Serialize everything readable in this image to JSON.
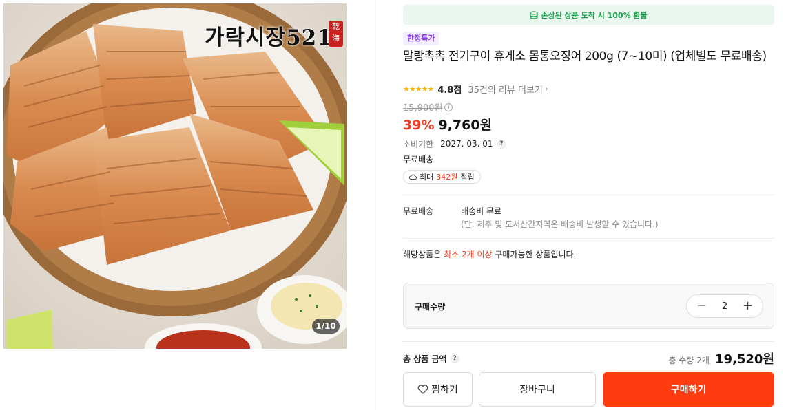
{
  "gallery": {
    "brand_text": "가락시장521",
    "seal_text": "乾海",
    "counter": "1/10"
  },
  "notice": {
    "text": "손상된 상품 도착 시 100% 환불",
    "icon": "coin-stack-icon"
  },
  "product": {
    "tag": "한정특가",
    "title": "말랑촉촉 전기구이 휴게소 몸통오징어 200g (7~10미) (업체별도 무료배송)",
    "stars": "★★★★★",
    "rating": "4.8점",
    "reviews_link": "35건의 리뷰 더보기",
    "original_price": "15,900원",
    "discount": "39%",
    "sale_price": "9,760원",
    "expiry_label": "소비기한",
    "expiry_date": "2027. 03. 01",
    "free_shipping": "무료배송",
    "points_prefix": "최대",
    "points_amount": "342원",
    "points_suffix": "적립"
  },
  "shipping": {
    "label": "무료배송",
    "fee": "배송비 무료",
    "note": "(단, 제주 및 도서산간지역은 배송비 발생할 수 있습니다.)"
  },
  "min_purchase": {
    "prefix": "해당상품은",
    "highlight": "최소 2개 이상",
    "suffix": "구매가능한 상품입니다."
  },
  "quantity": {
    "label": "구매수량",
    "value": "2",
    "minus": "−",
    "plus": "+"
  },
  "total": {
    "label": "총 상품 금액",
    "count": "총 수량 2개",
    "price": "19,520원"
  },
  "actions": {
    "wish": "찜하기",
    "cart": "장바구니",
    "buy": "구매하기"
  },
  "colors": {
    "accent": "#ff3b10",
    "discount": "#f33b1f",
    "notice_green": "#17a04a",
    "tag_purple": "#8a3cf0",
    "star": "#f7b500"
  }
}
